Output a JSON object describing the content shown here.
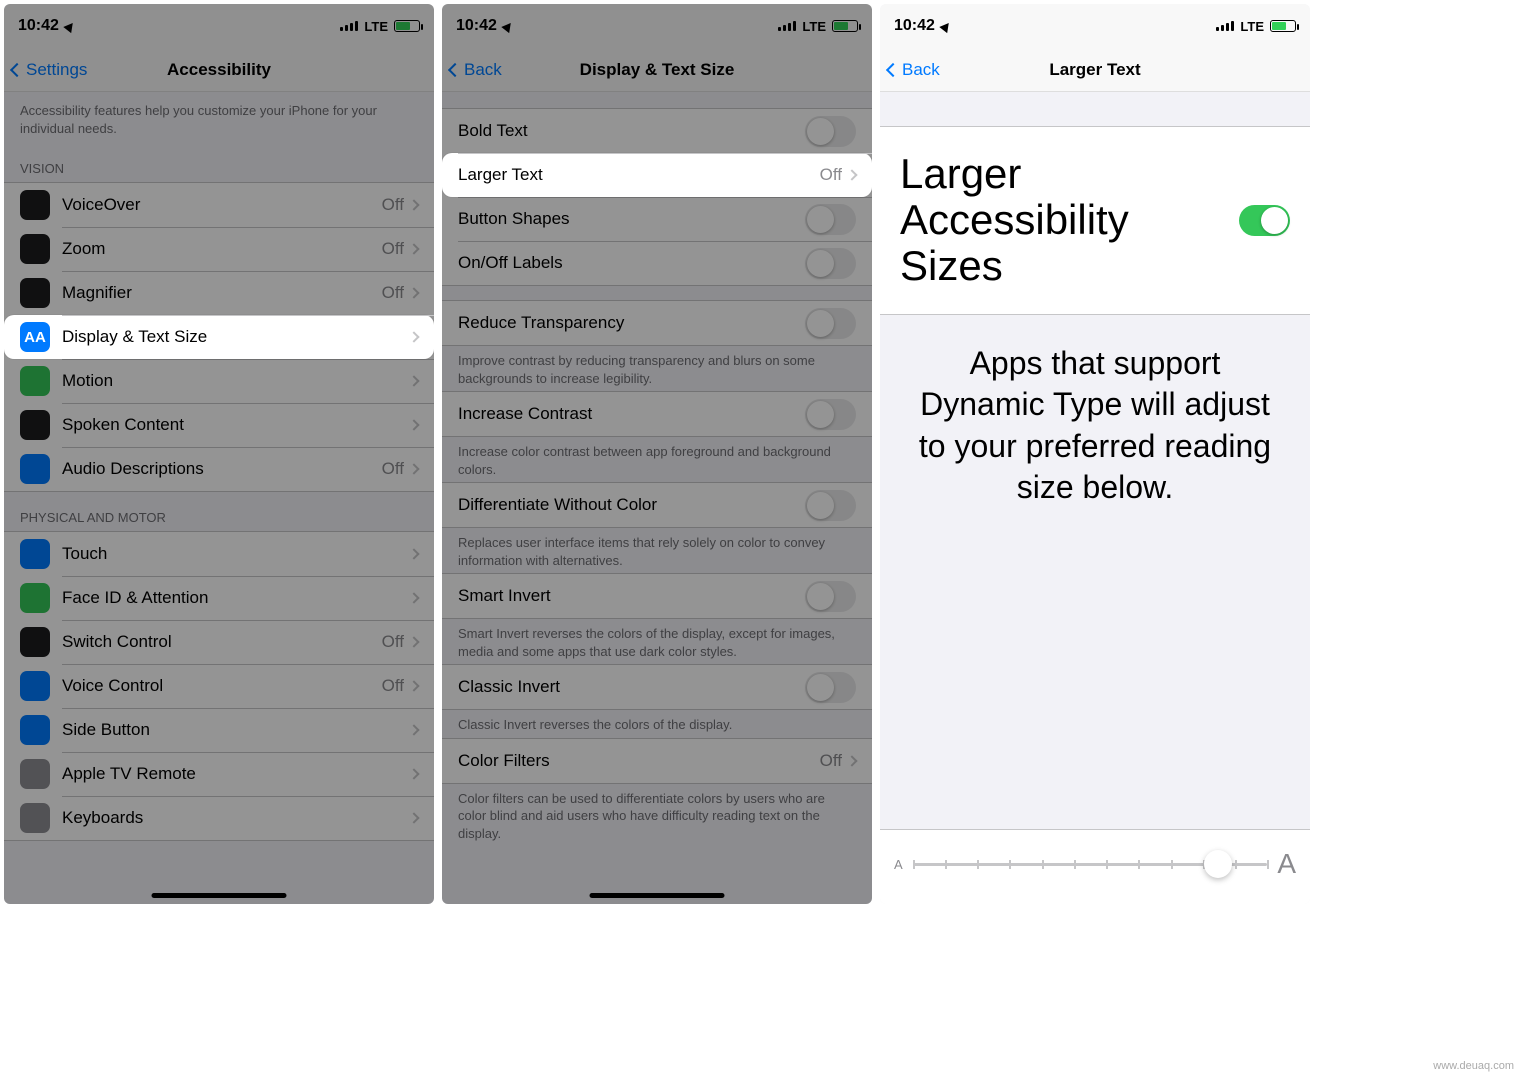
{
  "status": {
    "time": "10:42",
    "carrier": "LTE"
  },
  "s1": {
    "back": "Settings",
    "title": "Accessibility",
    "intro": "Accessibility features help you customize your iPhone for your individual needs.",
    "group1_header": "VISION",
    "group1": [
      {
        "label": "VoiceOver",
        "value": "Off",
        "icon": "ic-black"
      },
      {
        "label": "Zoom",
        "value": "Off",
        "icon": "ic-black"
      },
      {
        "label": "Magnifier",
        "value": "Off",
        "icon": "ic-black"
      },
      {
        "label": "Display & Text Size",
        "value": "",
        "icon": "ic-blue",
        "highlight": true
      },
      {
        "label": "Motion",
        "value": "",
        "icon": "ic-green"
      },
      {
        "label": "Spoken Content",
        "value": "",
        "icon": "ic-black"
      },
      {
        "label": "Audio Descriptions",
        "value": "Off",
        "icon": "ic-blue"
      }
    ],
    "group2_header": "PHYSICAL AND MOTOR",
    "group2": [
      {
        "label": "Touch",
        "value": "",
        "icon": "ic-blue"
      },
      {
        "label": "Face ID & Attention",
        "value": "",
        "icon": "ic-green"
      },
      {
        "label": "Switch Control",
        "value": "Off",
        "icon": "ic-black"
      },
      {
        "label": "Voice Control",
        "value": "Off",
        "icon": "ic-blue"
      },
      {
        "label": "Side Button",
        "value": "",
        "icon": "ic-blue"
      },
      {
        "label": "Apple TV Remote",
        "value": "",
        "icon": "ic-grey"
      },
      {
        "label": "Keyboards",
        "value": "",
        "icon": "ic-grey"
      }
    ]
  },
  "s2": {
    "back": "Back",
    "title": "Display & Text Size",
    "rows": {
      "bold": "Bold Text",
      "larger": "Larger Text",
      "larger_val": "Off",
      "shapes": "Button Shapes",
      "onoff": "On/Off Labels",
      "reduce_t": "Reduce Transparency",
      "reduce_t_note": "Improve contrast by reducing transparency and blurs on some backgrounds to increase legibility.",
      "contrast": "Increase Contrast",
      "contrast_note": "Increase color contrast between app foreground and background colors.",
      "diff": "Differentiate Without Color",
      "diff_note": "Replaces user interface items that rely solely on color to convey information with alternatives.",
      "smart": "Smart Invert",
      "smart_note": "Smart Invert reverses the colors of the display, except for images, media and some apps that use dark color styles.",
      "classic": "Classic Invert",
      "classic_note": "Classic Invert reverses the colors of the display.",
      "filters": "Color Filters",
      "filters_val": "Off",
      "filters_note": "Color filters can be used to differentiate colors by users who are color blind and aid users who have difficulty reading text on the display."
    }
  },
  "s3": {
    "back": "Back",
    "title": "Larger Text",
    "row_label": "Larger Accessibility Sizes",
    "note": "Apps that support Dynamic Type will adjust to your preferred reading size below.",
    "slider": {
      "ticks": 12,
      "position_pct": 86
    }
  },
  "watermark": "www.deuaq.com"
}
